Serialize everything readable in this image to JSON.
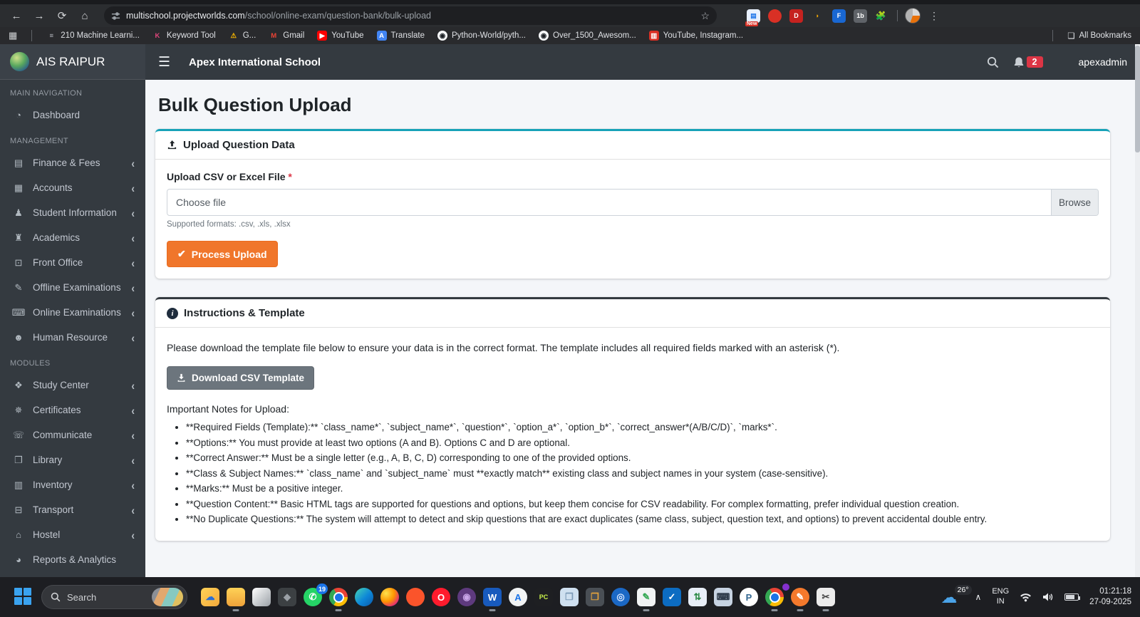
{
  "browser": {
    "url_host": "multischool.projectworlds.com",
    "url_path": "/school/online-exam/question-bank/bulk-upload",
    "all_bookmarks_label": "All Bookmarks",
    "bookmarks": [
      {
        "name": "bookmark-210-machine-learning",
        "label": "210 Machine Learni...",
        "bg": "transparent",
        "glyph": "≡",
        "fg": "#aeb2b8"
      },
      {
        "name": "bookmark-keyword-tool",
        "label": "Keyword Tool",
        "bg": "transparent",
        "glyph": "K",
        "fg": "#e0457b"
      },
      {
        "name": "bookmark-g",
        "label": "G...",
        "bg": "transparent",
        "glyph": "⚠",
        "fg": "#f5b400"
      },
      {
        "name": "bookmark-gmail",
        "label": "Gmail",
        "bg": "transparent",
        "glyph": "M",
        "fg": "#ea4335"
      },
      {
        "name": "bookmark-youtube",
        "label": "YouTube",
        "bg": "#ff0000",
        "glyph": "▶",
        "fg": "#ffffff"
      },
      {
        "name": "bookmark-translate",
        "label": "Translate",
        "bg": "#4285f4",
        "glyph": "A",
        "fg": "#ffffff"
      },
      {
        "name": "bookmark-python-world",
        "label": "Python-World/pyth...",
        "bg": "#f6f8fa",
        "glyph": "◉",
        "fg": "#1b1f24",
        "circle": true
      },
      {
        "name": "bookmark-over-1500-awesome",
        "label": "Over_1500_Awesom...",
        "bg": "#f6f8fa",
        "glyph": "◉",
        "fg": "#1b1f24",
        "circle": true
      },
      {
        "name": "bookmark-youtube-instagram",
        "label": "YouTube, Instagram...",
        "bg": "#d93025",
        "glyph": "▥",
        "fg": "#ffffff"
      }
    ],
    "extensions": [
      {
        "name": "ext-new-tool",
        "bg": "#e8f0fe",
        "glyph": "▤",
        "fg": "#1a73e8",
        "badge": "New"
      },
      {
        "name": "ext-red-circle",
        "bg": "#d93025",
        "glyph": "",
        "fg": "#ffffff",
        "circle": true
      },
      {
        "name": "ext-d-downloader",
        "bg": "#c5221f",
        "glyph": "D",
        "fg": "#ffffff"
      },
      {
        "name": "ext-idm",
        "bg": "transparent",
        "glyph": "◗",
        "fg": "#f9ab00"
      },
      {
        "name": "ext-f-video",
        "bg": "#1967d2",
        "glyph": "F",
        "fg": "#ffffff"
      },
      {
        "name": "ext-1b-grey",
        "bg": "#5f6368",
        "glyph": "1b",
        "fg": "#ffffff"
      }
    ]
  },
  "sidebar": {
    "brand": "AIS RAIPUR",
    "sections": [
      {
        "label": "MAIN NAVIGATION",
        "items": [
          {
            "name": "dashboard",
            "label": "Dashboard",
            "glyph": "◔",
            "chevron": false
          }
        ]
      },
      {
        "label": "MANAGEMENT",
        "items": [
          {
            "name": "finance-fees",
            "label": "Finance & Fees",
            "glyph": "▤",
            "chevron": true
          },
          {
            "name": "accounts",
            "label": "Accounts",
            "glyph": "▦",
            "chevron": true
          },
          {
            "name": "student-information",
            "label": "Student Information",
            "glyph": "♟",
            "chevron": true
          },
          {
            "name": "academics",
            "label": "Academics",
            "glyph": "♜",
            "chevron": true
          },
          {
            "name": "front-office",
            "label": "Front Office",
            "glyph": "⊡",
            "chevron": true
          },
          {
            "name": "offline-examinations",
            "label": "Offline Examinations",
            "glyph": "✎",
            "chevron": true
          },
          {
            "name": "online-examinations",
            "label": "Online Examinations",
            "glyph": "⌨",
            "chevron": true
          },
          {
            "name": "human-resource",
            "label": "Human Resource",
            "glyph": "☻",
            "chevron": true
          }
        ]
      },
      {
        "label": "MODULES",
        "items": [
          {
            "name": "study-center",
            "label": "Study Center",
            "glyph": "❖",
            "chevron": true
          },
          {
            "name": "certificates",
            "label": "Certificates",
            "glyph": "✵",
            "chevron": true
          },
          {
            "name": "communicate",
            "label": "Communicate",
            "glyph": "☏",
            "chevron": true
          },
          {
            "name": "library",
            "label": "Library",
            "glyph": "❐",
            "chevron": true
          },
          {
            "name": "inventory",
            "label": "Inventory",
            "glyph": "▥",
            "chevron": true
          },
          {
            "name": "transport",
            "label": "Transport",
            "glyph": "⊟",
            "chevron": true
          },
          {
            "name": "hostel",
            "label": "Hostel",
            "glyph": "⌂",
            "chevron": true
          },
          {
            "name": "reports-analytics",
            "label": "Reports & Analytics",
            "glyph": "◕",
            "chevron": false
          }
        ]
      }
    ]
  },
  "navbar": {
    "school_name": "Apex International School",
    "notification_count": "2",
    "username": "apexadmin"
  },
  "page": {
    "title": "Bulk Question Upload"
  },
  "upload_card": {
    "title": "Upload Question Data",
    "file_label": "Upload CSV or Excel File",
    "required_mark": "*",
    "file_placeholder": "Choose file",
    "browse_label": "Browse",
    "supported_formats": "Supported formats: .csv, .xls, .xlsx",
    "process_button": "Process Upload"
  },
  "instructions_card": {
    "title": "Instructions & Template",
    "intro": "Please download the template file below to ensure your data is in the correct format. The template includes all required fields marked with an asterisk (*).",
    "download_button": "Download CSV Template",
    "notes_title": "Important Notes for Upload:",
    "notes": [
      "**Required Fields (Template):** `class_name*`, `subject_name*`, `question*`, `option_a*`, `option_b*`, `correct_answer*(A/B/C/D)`, `marks*`.",
      "**Options:** You must provide at least two options (A and B). Options C and D are optional.",
      "**Correct Answer:** Must be a single letter (e.g., A, B, C, D) corresponding to one of the provided options.",
      "**Class & Subject Names:** `class_name` and `subject_name` must **exactly match** existing class and subject names in your system (case-sensitive).",
      "**Marks:** Must be a positive integer.",
      "**Question Content:** Basic HTML tags are supported for questions and options, but keep them concise for CSV readability. For complex formatting, prefer individual question creation.",
      "**No Duplicate Questions:** The system will attempt to detect and skip questions that are exact duplicates (same class, subject, question text, and options) to prevent accidental double entry."
    ]
  },
  "taskbar": {
    "search_placeholder": "Search",
    "apps": [
      {
        "name": "onedrive-folder",
        "bg": "linear-gradient(135deg,#ffd257,#f3a93c)",
        "glyph": "☁",
        "fg": "#2a6fd4"
      },
      {
        "name": "file-explorer",
        "bg": "linear-gradient(180deg,#ffd257,#eea23a)",
        "glyph": "",
        "fg": "#fff",
        "running": true
      },
      {
        "name": "photos-app",
        "bg": "linear-gradient(135deg,#ffffff,#9aa0a6)",
        "glyph": "",
        "fg": "#666"
      },
      {
        "name": "dark-hex-app",
        "bg": "#3c4043",
        "glyph": "◆",
        "fg": "#9aa0a6"
      },
      {
        "name": "whatsapp",
        "bg": "#25d366",
        "glyph": "✆",
        "fg": "#ffffff",
        "circle": true,
        "badge": "19",
        "badge_bg": "#1a73e8"
      },
      {
        "name": "chrome",
        "cls": "chrome",
        "running": true
      },
      {
        "name": "edge",
        "bg": "linear-gradient(135deg,#45d6b5,#0d86d8 55%,#0b59a9)",
        "glyph": "",
        "fg": "#fff",
        "circle": true
      },
      {
        "name": "firefox",
        "bg": "radial-gradient(circle at 30% 30%,#ffe14d,#ff9500 45%,#e6336b 75%,#7a2ccc)",
        "glyph": "",
        "fg": "#fff",
        "circle": true
      },
      {
        "name": "brave",
        "bg": "#fb542b",
        "glyph": "",
        "fg": "#fff",
        "circle": true
      },
      {
        "name": "opera",
        "bg": "#ff1b2d",
        "glyph": "O",
        "fg": "#ffffff",
        "circle": true
      },
      {
        "name": "tor-browser",
        "bg": "#5e3a7e",
        "glyph": "◉",
        "fg": "#c9a6e8",
        "circle": true
      },
      {
        "name": "word",
        "bg": "#185abd",
        "glyph": "W",
        "fg": "#ffffff",
        "running": true
      },
      {
        "name": "app-store-a",
        "bg": "#f1f3f4",
        "glyph": "A",
        "fg": "#1a73e8",
        "circle": true
      },
      {
        "name": "pycharm",
        "bg": "#1e1f22",
        "glyph": "PC",
        "fg": "#c8f24a",
        "small": true
      },
      {
        "name": "cube-viewer",
        "bg": "#cfe0f0",
        "glyph": "❒",
        "fg": "#7d9bb8"
      },
      {
        "name": "cube-dark",
        "bg": "#4a4f55",
        "glyph": "❒",
        "fg": "#e2a23c"
      },
      {
        "name": "blue-disc-app",
        "bg": "#1b68c5",
        "glyph": "◎",
        "fg": "#d6e6ff",
        "circle": true
      },
      {
        "name": "notes-app",
        "bg": "#f1f3f4",
        "glyph": "✎",
        "fg": "#34a853",
        "running": true
      },
      {
        "name": "vscode",
        "bg": "#0c6cc2",
        "glyph": "✓",
        "fg": "#ffffff"
      },
      {
        "name": "lock-sync",
        "bg": "#e8eef7",
        "glyph": "⇅",
        "fg": "#2d8a46"
      },
      {
        "name": "remote-pc",
        "bg": "#c7d3e2",
        "glyph": "⌨",
        "fg": "#2f3b4a"
      },
      {
        "name": "postgresql",
        "bg": "#ffffff",
        "glyph": "P",
        "fg": "#336791",
        "circle": true
      },
      {
        "name": "chrome-dev",
        "cls": "chrome",
        "badge": "",
        "badge_bg": "#8430ce",
        "running": true
      },
      {
        "name": "pen-app",
        "bg": "#f4792c",
        "glyph": "✎",
        "fg": "#ffffff",
        "circle": true,
        "running": true
      },
      {
        "name": "snipping-tool",
        "bg": "#ececec",
        "glyph": "✂",
        "fg": "#444444",
        "running": true
      }
    ],
    "tray": {
      "temp": "26°",
      "lang_line1": "ENG",
      "lang_line2": "IN",
      "time": "01:21:18",
      "date": "27-09-2025"
    }
  },
  "colors": {
    "accent_teal": "#17a2b8",
    "accent_orange": "#f0762b",
    "danger": "#dc3545",
    "navbar_dark": "#343a40"
  }
}
